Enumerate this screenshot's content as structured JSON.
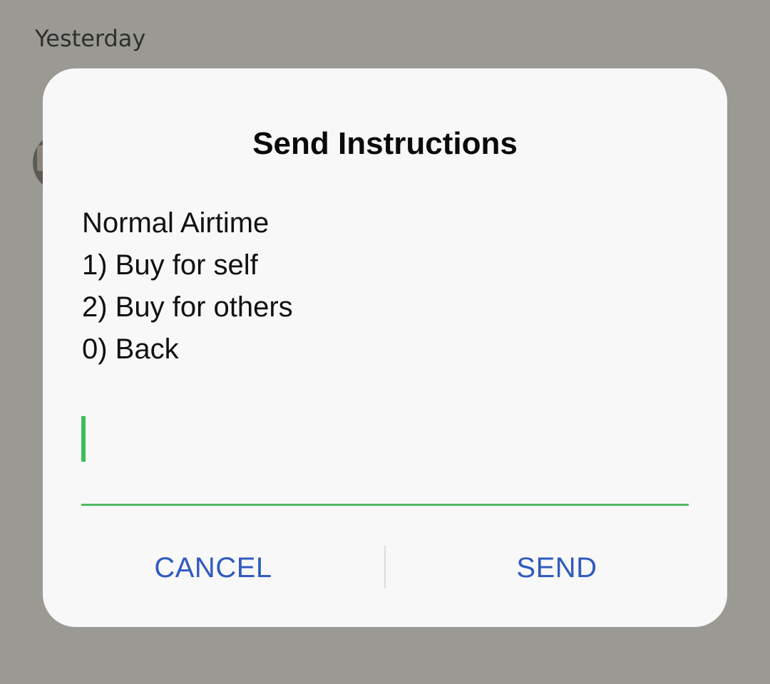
{
  "background": {
    "date_header": "Yesterday",
    "scrim_color": "#9a9994"
  },
  "dialog": {
    "title": "Send Instructions",
    "message_lines": [
      "Normal Airtime",
      "1) Buy for self",
      "2) Buy for others",
      "0) Back"
    ],
    "input": {
      "value": "",
      "accent_color": "#4fba66"
    },
    "buttons": {
      "cancel_label": "CANCEL",
      "send_label": "SEND",
      "label_color": "#2f5bbf"
    }
  }
}
